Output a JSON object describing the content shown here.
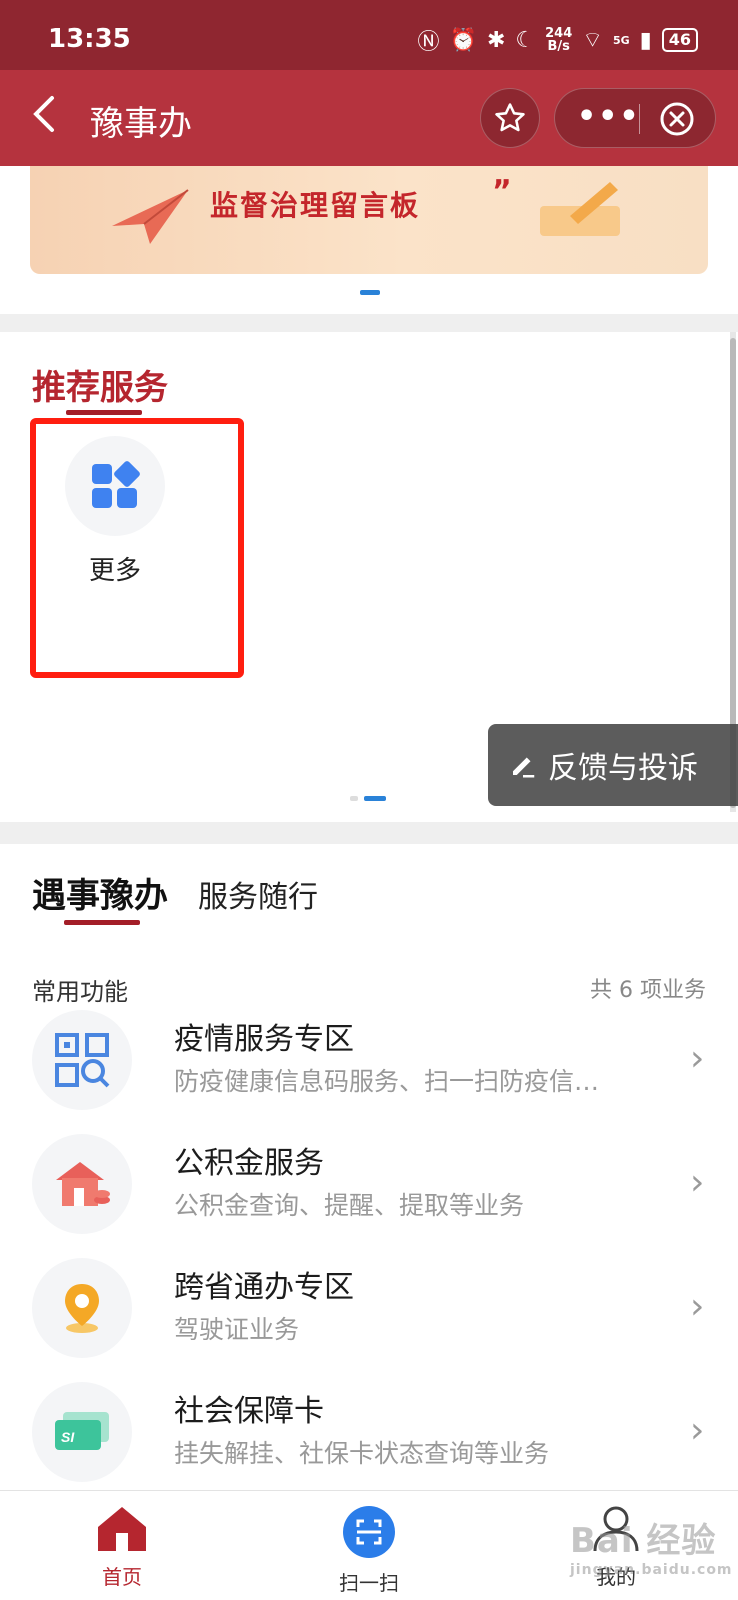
{
  "status_bar": {
    "time": "13:35",
    "net_speed_value": "244",
    "net_speed_unit": "B/s",
    "network": "5G",
    "battery": "46"
  },
  "nav": {
    "title": "豫事办",
    "back_icon": "chevron-left-icon"
  },
  "banner": {
    "text": "监督治理留言板",
    "page_dot_color": "#2a82d8"
  },
  "recommended": {
    "title": "推荐服务",
    "items": [
      {
        "label": "更多",
        "icon": "apps-grid-icon"
      }
    ]
  },
  "feedback": {
    "label": "反馈与投诉"
  },
  "services": {
    "tabs": [
      {
        "label": "遇事豫办",
        "active": true
      },
      {
        "label": "服务随行",
        "active": false
      }
    ],
    "common_label": "常用功能",
    "count_label": "共 6 项业务",
    "items": [
      {
        "title": "疫情服务专区",
        "subtitle": "防疫健康信息码服务、扫一扫防疫信…",
        "icon": "qr-code-icon"
      },
      {
        "title": "公积金服务",
        "subtitle": "公积金查询、提醒、提取等业务",
        "icon": "house-fund-icon"
      },
      {
        "title": "跨省通办专区",
        "subtitle": "驾驶证业务",
        "icon": "location-pin-icon"
      },
      {
        "title": "社会保障卡",
        "subtitle": "挂失解挂、社保卡状态查询等业务",
        "icon": "social-security-card-icon"
      }
    ]
  },
  "tabbar": {
    "items": [
      {
        "label": "首页",
        "icon": "home-icon",
        "active": true
      },
      {
        "label": "扫一扫",
        "icon": "scan-icon",
        "active": false
      },
      {
        "label": "我的",
        "icon": "user-icon",
        "active": false
      }
    ]
  },
  "watermark": {
    "text": "Bai 经验",
    "sub": "jingyan.baidu.com"
  },
  "colors": {
    "brand_red": "#b5333e",
    "status_red": "#8f2630",
    "accent_blue": "#3f82f0",
    "highlight": "#ff1e10"
  }
}
